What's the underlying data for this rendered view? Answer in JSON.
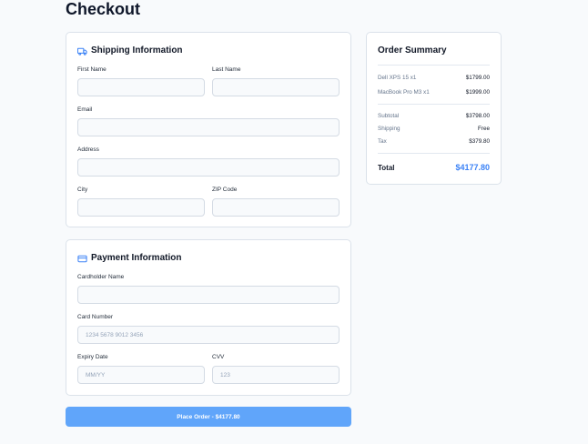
{
  "page_title": "Checkout",
  "colors": {
    "accent": "#3b82f6",
    "button": "#60a5fa"
  },
  "shipping": {
    "title": "Shipping Information",
    "icon": "truck-icon",
    "first_name_label": "First Name",
    "last_name_label": "Last Name",
    "email_label": "Email",
    "address_label": "Address",
    "city_label": "City",
    "zip_label": "ZIP Code"
  },
  "payment": {
    "title": "Payment Information",
    "icon": "credit-card-icon",
    "cardholder_label": "Cardholder Name",
    "card_number_label": "Card Number",
    "card_number_placeholder": "1234 5678 9012 3456",
    "expiry_label": "Expiry Date",
    "expiry_placeholder": "MM/YY",
    "cvv_label": "CVV",
    "cvv_placeholder": "123"
  },
  "summary": {
    "title": "Order Summary",
    "items": [
      {
        "name": "Dell XPS 15 x1",
        "price": "$1799.00"
      },
      {
        "name": "MacBook Pro M3 x1",
        "price": "$1999.00"
      }
    ],
    "subtotal_label": "Subtotal",
    "subtotal_value": "$3798.00",
    "shipping_label": "Shipping",
    "shipping_value": "Free",
    "tax_label": "Tax",
    "tax_value": "$379.80",
    "total_label": "Total",
    "total_value": "$4177.80"
  },
  "place_order_label": "Place Order - $4177.80"
}
